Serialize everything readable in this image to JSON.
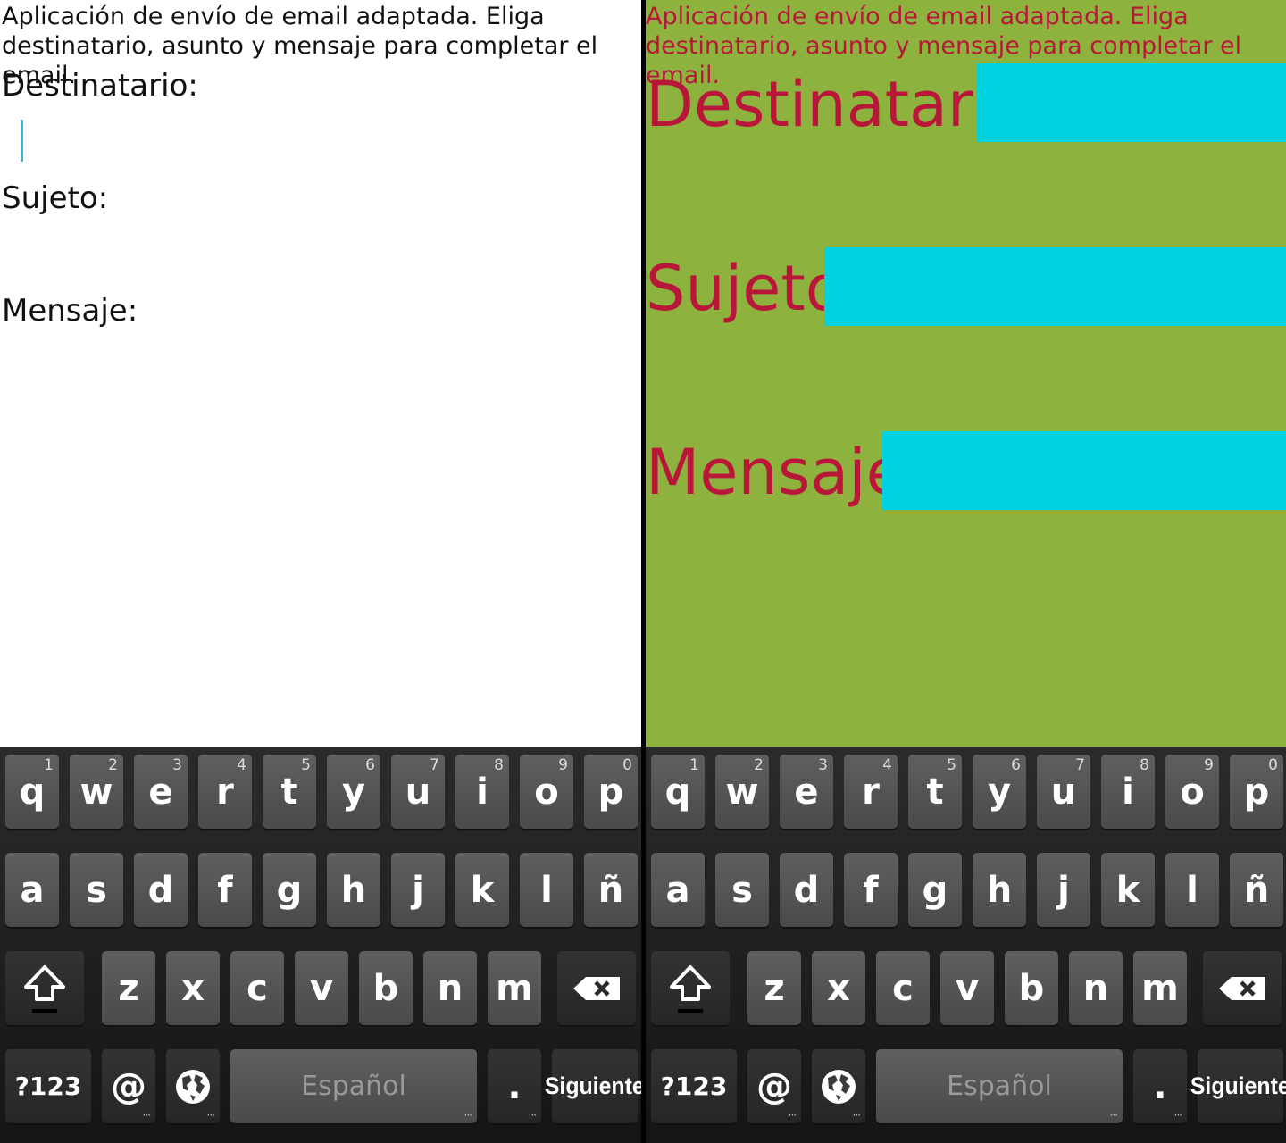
{
  "form": {
    "intro": "Aplicación de envío de email adaptada. Eliga destinatario, asunto y mensaje para completar el email.",
    "to_label": "Destinatario:",
    "subject_label": "Sujeto:",
    "message_label": "Mensaje:"
  },
  "keyboard": {
    "row1": [
      {
        "k": "q",
        "n": "1"
      },
      {
        "k": "w",
        "n": "2"
      },
      {
        "k": "e",
        "n": "3"
      },
      {
        "k": "r",
        "n": "4"
      },
      {
        "k": "t",
        "n": "5"
      },
      {
        "k": "y",
        "n": "6"
      },
      {
        "k": "u",
        "n": "7"
      },
      {
        "k": "i",
        "n": "8"
      },
      {
        "k": "o",
        "n": "9"
      },
      {
        "k": "p",
        "n": "0"
      }
    ],
    "row2": [
      "a",
      "s",
      "d",
      "f",
      "g",
      "h",
      "j",
      "k",
      "l",
      "ñ"
    ],
    "row3": [
      "z",
      "x",
      "c",
      "v",
      "b",
      "n",
      "m"
    ],
    "symbols": "?123",
    "at": "@",
    "space": "Español",
    "period": ".",
    "next": "Siguiente"
  },
  "colors": {
    "right_background": "#8db33e",
    "right_text": "#b8173a",
    "right_field": "#00d2e2",
    "cursor": "#33b5e5"
  }
}
